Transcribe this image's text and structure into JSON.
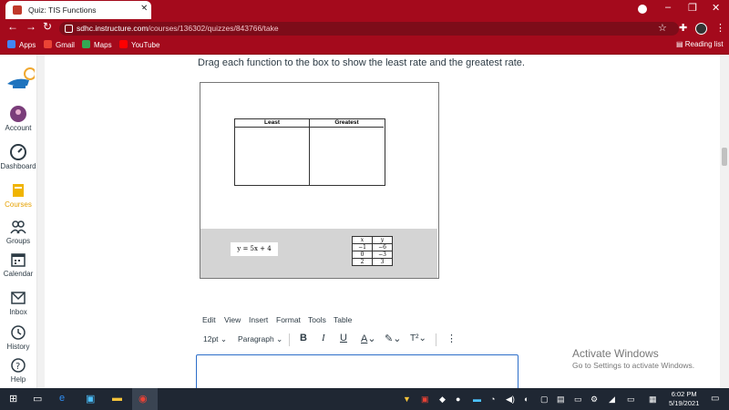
{
  "browser": {
    "tab_title": "Quiz: TIS Functions",
    "url_host": "sdhc.instructure.com",
    "url_path": "/courses/136302/quizzes/843766/take",
    "bookmarks": [
      {
        "label": "Apps",
        "color": "#4285f4"
      },
      {
        "label": "Gmail",
        "color": "#ea4335"
      },
      {
        "label": "Maps",
        "color": "#34a853"
      },
      {
        "label": "YouTube",
        "color": "#ff0000"
      }
    ],
    "reading_list": "Reading list"
  },
  "leftnav": {
    "items": [
      "Account",
      "Dashboard",
      "Courses",
      "Groups",
      "Calendar",
      "Inbox",
      "History",
      "Help"
    ]
  },
  "question": {
    "prompt": "Drag each function to the box to show the least rate and the greatest rate.",
    "col_least": "Least",
    "col_greatest": "Greatest",
    "function_card": "y = 5x + 4",
    "table": {
      "headers": [
        "x",
        "y"
      ],
      "rows": [
        [
          "−1",
          "−6"
        ],
        [
          "0",
          "−3"
        ],
        [
          "2",
          "3"
        ]
      ]
    }
  },
  "editor": {
    "menus": [
      "Edit",
      "View",
      "Insert",
      "Format",
      "Tools",
      "Table"
    ],
    "font_size": "12pt",
    "block_format": "Paragraph"
  },
  "watermark": {
    "title": "Activate Windows",
    "subtitle": "Go to Settings to activate Windows."
  },
  "taskbar": {
    "time": "6:02 PM",
    "date": "5/19/2021"
  }
}
